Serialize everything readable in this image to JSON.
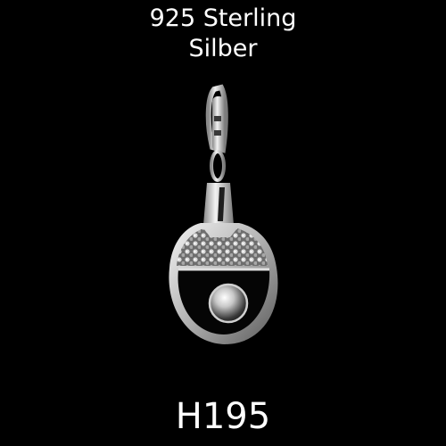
{
  "caption": {
    "line1": "925 Sterling",
    "line2": "Silber"
  },
  "product_code": "H195",
  "colors": {
    "background": "#000000",
    "text": "#ffffff",
    "silver_light": "#e8e8e8",
    "silver_dark": "#6a6a6a"
  }
}
